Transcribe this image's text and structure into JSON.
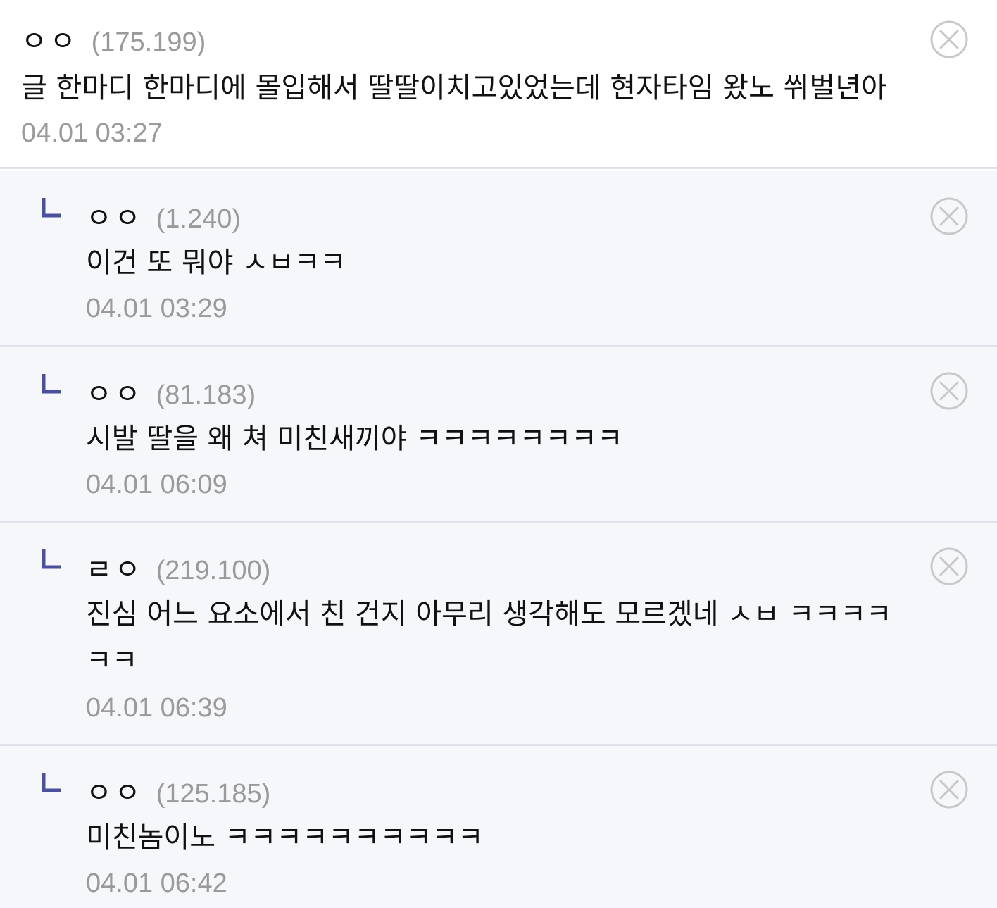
{
  "comments": [
    {
      "author": "ㅇㅇ",
      "ip": "(175.199)",
      "text": "글 한마디 한마디에 몰입해서 딸딸이치고있었는데 현자타임 왔노 쒸벌년아",
      "date": "04.01 03:27"
    }
  ],
  "replies": [
    {
      "author": "ㅇㅇ",
      "ip": "(1.240)",
      "text": "이건 또 뭐야 ㅅㅂㅋㅋ",
      "date": "04.01 03:29"
    },
    {
      "author": "ㅇㅇ",
      "ip": "(81.183)",
      "text": "시발 딸을 왜 쳐 미친새끼야 ㅋㅋㅋㅋㅋㅋㅋㅋ",
      "date": "04.01 06:09"
    },
    {
      "author": "ㄹㅇ",
      "ip": "(219.100)",
      "text_line1": "진심 어느 요소에서 친 건지 아무리 생각해도 모르겠네 ㅅㅂ ㅋㅋㅋㅋ",
      "text_line2": "ㅋㅋ",
      "date": "04.01 06:39"
    },
    {
      "author": "ㅇㅇ",
      "ip": "(125.185)",
      "text": "미친놈이노 ㅋㅋㅋㅋㅋㅋㅋㅋㅋㅋ",
      "date": "04.01 06:42"
    }
  ],
  "icons": {
    "delete": "close-circle-icon",
    "reply": "reply-corner-icon"
  },
  "colors": {
    "reply_mark": "#4a4f9e",
    "muted_text": "#9a9a9a",
    "reply_background": "#f6f7fa",
    "divider": "#dfe2ea"
  }
}
